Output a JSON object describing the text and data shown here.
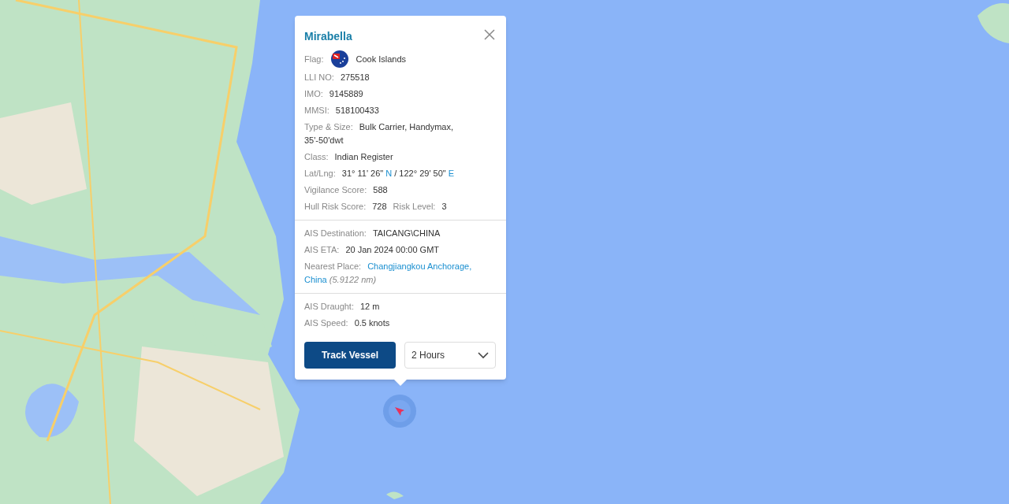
{
  "vessel": {
    "name": "Mirabella"
  },
  "sections": [
    {
      "fields": [
        {
          "kind": "flag",
          "label": "Flag:",
          "value": "Cook Islands"
        },
        {
          "kind": "text",
          "label": "LLI NO:",
          "value": "275518"
        },
        {
          "kind": "text",
          "label": "IMO:",
          "value": "9145889"
        },
        {
          "kind": "text",
          "label": "MMSI:",
          "value": "518100433"
        },
        {
          "kind": "lines",
          "label": "Type & Size:",
          "value_lines": [
            "Bulk Carrier, Handymax,",
            "35'-50'dwt"
          ]
        },
        {
          "kind": "text",
          "label": "Class:",
          "value": "Indian Register"
        },
        {
          "kind": "coords",
          "label": "Lat/Lng:",
          "lat": "31° 11' 26\"",
          "lat_hemisphere": "N",
          "separator": "/",
          "lng": "122° 29' 50\"",
          "lng_hemisphere": "E"
        },
        {
          "kind": "text",
          "label": "Vigilance Score:",
          "value": "588"
        },
        {
          "kind": "pair",
          "label": "Hull Risk Score:",
          "value": "728",
          "label2": "Risk Level:",
          "value2": "3"
        }
      ]
    },
    {
      "fields": [
        {
          "kind": "text",
          "label": "AIS Destination:",
          "value": "TAICANG\\CHINA"
        },
        {
          "kind": "text",
          "label": "AIS ETA:",
          "value": "20 Jan 2024 00:00 GMT"
        },
        {
          "kind": "link",
          "label": "Nearest Place:",
          "value_lines": [
            "Changjiangkou Anchorage,",
            "China"
          ],
          "note": "(5.9122 nm)"
        }
      ]
    },
    {
      "fields": [
        {
          "kind": "text",
          "label": "AIS Draught:",
          "value": "12 m"
        },
        {
          "kind": "text",
          "label": "AIS Speed:",
          "value": "0.5 knots"
        }
      ]
    }
  ],
  "track_button": "Track Vessel",
  "period_select": {
    "value": "2 Hours"
  }
}
